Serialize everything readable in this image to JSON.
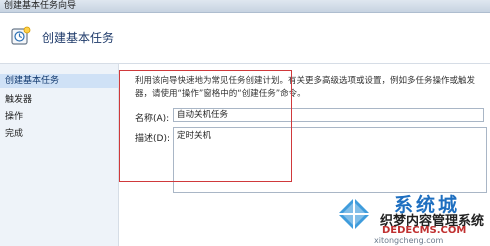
{
  "window": {
    "title": "创建基本任务向导"
  },
  "header": {
    "heading": "创建基本任务",
    "icon": "task-wizard-icon"
  },
  "sidebar": {
    "items": [
      {
        "label": "创建基本任务",
        "active": true
      },
      {
        "label": "触发器",
        "active": false
      },
      {
        "label": "操作",
        "active": false
      },
      {
        "label": "完成",
        "active": false
      }
    ]
  },
  "content": {
    "description_line1": "利用该向导快速地为常见任务创建计划。有关更多高级选项或设置，例如多任务操作或触发",
    "description_line2": "器，请使用“操作”窗格中的“创建任务”命令。",
    "name_label": "名称(A):",
    "name_value": "自动关机任务",
    "desc_label": "描述(D):",
    "desc_value": "定时关机"
  },
  "watermark": {
    "brand": "系统城",
    "site_cn": "织梦内容管理系统",
    "site_url1": "DEDECMS.COM",
    "site_url2": "xitongcheng.com"
  },
  "colors": {
    "accent": "#cfe1f6",
    "annotation": "#d0393b",
    "header_text": "#1e3a6a"
  }
}
